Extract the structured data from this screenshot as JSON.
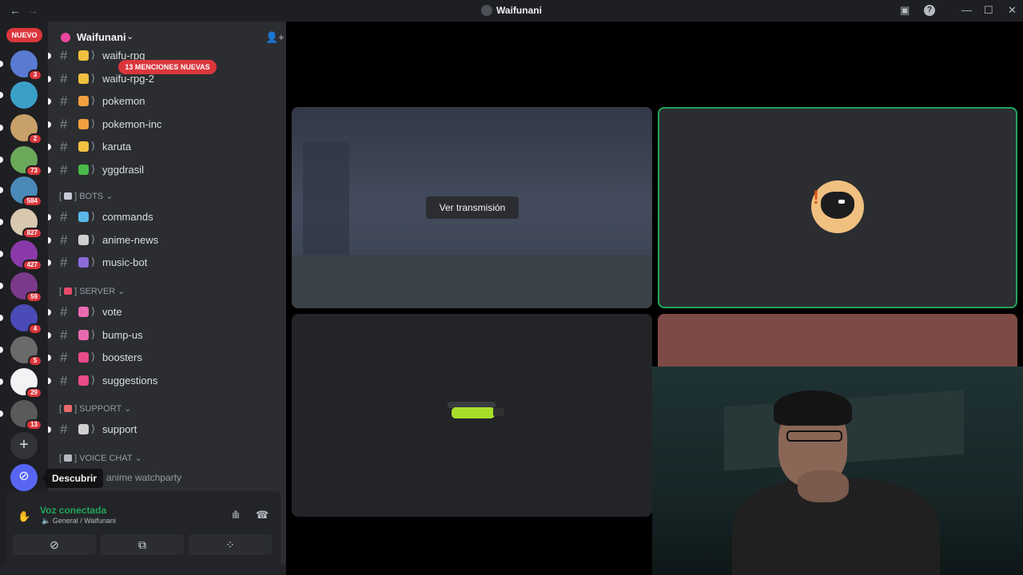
{
  "titlebar": {
    "title": "Waifunani",
    "back_icon": "←",
    "forward_icon": "→",
    "inbox_icon": "▣",
    "help_icon": "?",
    "minimize_icon": "—",
    "maximize_icon": "☐",
    "close_icon": "✕"
  },
  "rail": {
    "new_label": "NUEVO",
    "servers": [
      {
        "badge": "3",
        "color": "#5a7bd1"
      },
      {
        "badge": "",
        "color": "#3aa0c8"
      },
      {
        "badge": "2",
        "color": "#c8a06a"
      },
      {
        "badge": "73",
        "color": "#6aa85a"
      },
      {
        "badge": "584",
        "color": "#4a8ab8"
      },
      {
        "badge": "827",
        "color": "#d8c8b0"
      },
      {
        "badge": "427",
        "color": "#8a3aa8"
      },
      {
        "badge": "59",
        "color": "#7a3a8a"
      },
      {
        "badge": "4",
        "color": "#4a4ab8"
      },
      {
        "badge": "5",
        "color": "#6a6a6a"
      },
      {
        "badge": "29",
        "color": "#f2f3f5"
      },
      {
        "badge": "13",
        "color": "#5a5a5a"
      }
    ],
    "add_label": "+",
    "discover_label": "⊘"
  },
  "guild": {
    "name": "Waifunani",
    "chevron": "⌄",
    "add_member_icon": "👤+",
    "mentions_label": "13 MENCIONES NUEVAS"
  },
  "channels": [
    {
      "name": "waifu-rpg",
      "emoji_color": "#f0c040"
    },
    {
      "name": "waifu-rpg-2",
      "emoji_color": "#f0c040"
    },
    {
      "name": "pokemon",
      "emoji_color": "#f0a040"
    },
    {
      "name": "pokemon-inc",
      "emoji_color": "#f0a040"
    },
    {
      "name": "karuta",
      "emoji_color": "#f0c040"
    },
    {
      "name": "yggdrasil",
      "emoji_color": "#4ab84a"
    }
  ],
  "categories": {
    "bots": {
      "label": "BOTS",
      "bracket": "[",
      "end": "]"
    },
    "server": {
      "label": "SERVER",
      "bracket": "[",
      "end": "]"
    },
    "support": {
      "label": "SUPPORT",
      "bracket": "[",
      "end": "]"
    },
    "voice": {
      "label": "VOICE CHAT",
      "bracket": "[",
      "end": "]"
    }
  },
  "bots_channels": [
    {
      "name": "commands",
      "emoji_color": "#5ab8e8"
    },
    {
      "name": "anime-news",
      "emoji_color": "#d0d0d0"
    },
    {
      "name": "music-bot",
      "emoji_color": "#8a6ad8"
    }
  ],
  "server_channels": [
    {
      "name": "vote",
      "emoji_color": "#e86ab0"
    },
    {
      "name": "bump-us",
      "emoji_color": "#e86ab0"
    },
    {
      "name": "boosters",
      "emoji_color": "#e84a8a"
    },
    {
      "name": "suggestions",
      "emoji_color": "#e84a8a"
    }
  ],
  "support_channels": [
    {
      "name": "support",
      "emoji_color": "#d0d0d0"
    }
  ],
  "voice_channel_partial": "anime watchparty",
  "tooltip": "Descubrir",
  "voice": {
    "status": "Voz conectada",
    "location": "General / Waifunani",
    "noise_icon": "ıllı",
    "disconnect_icon": "☎"
  },
  "stage": {
    "watch_stream_label": "Ver transmisión"
  }
}
